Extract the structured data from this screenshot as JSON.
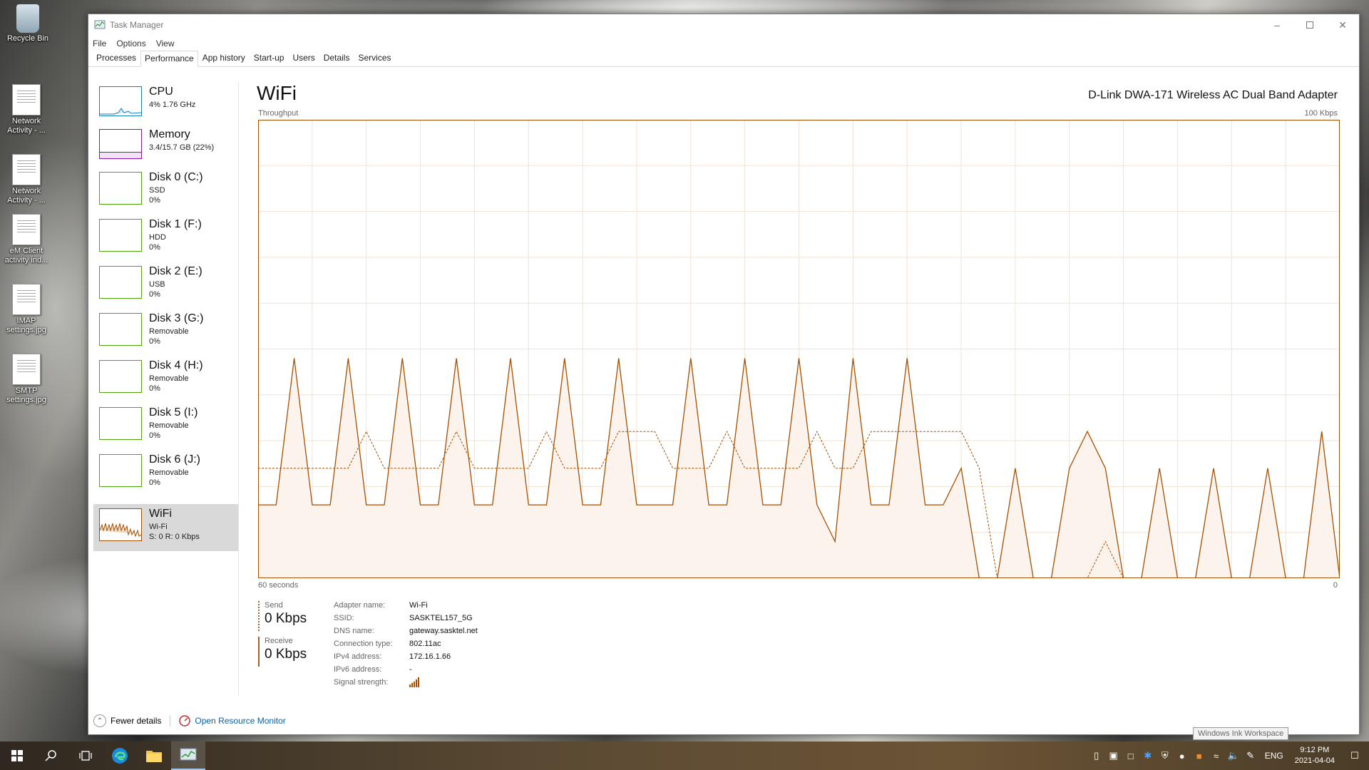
{
  "desktop": {
    "icons": [
      {
        "label": "Recycle Bin",
        "icon": "recycle-bin-icon"
      },
      {
        "label": "Network Activity - ...",
        "icon": "shortcut-icon"
      },
      {
        "label": "Network Activity - ...",
        "icon": "shortcut-icon"
      },
      {
        "label": "eM Client activity ind...",
        "icon": "document-icon"
      },
      {
        "label": "IMAP settings.jpg",
        "icon": "image-file-icon"
      },
      {
        "label": "SMTP settings.jpg",
        "icon": "image-file-icon"
      }
    ]
  },
  "window": {
    "title": "Task Manager",
    "menu": [
      "File",
      "Options",
      "View"
    ],
    "tabs": [
      "Processes",
      "Performance",
      "App history",
      "Start-up",
      "Users",
      "Details",
      "Services"
    ],
    "active_tab": "Performance"
  },
  "sidebar": {
    "items": [
      {
        "name": "CPU",
        "sub1": "4% 1.76 GHz",
        "sub2": "",
        "color": "#117dbb"
      },
      {
        "name": "Memory",
        "sub1": "3.4/15.7 GB (22%)",
        "sub2": "",
        "color": "#8b12ae"
      },
      {
        "name": "Disk 0 (C:)",
        "sub1": "SSD",
        "sub2": "0%",
        "color": "#4da60c"
      },
      {
        "name": "Disk 1 (F:)",
        "sub1": "HDD",
        "sub2": "0%",
        "color": "#4da60c"
      },
      {
        "name": "Disk 2 (E:)",
        "sub1": "USB",
        "sub2": "0%",
        "color": "#4da60c"
      },
      {
        "name": "Disk 3 (G:)",
        "sub1": "Removable",
        "sub2": "0%",
        "color": "#4da60c"
      },
      {
        "name": "Disk 4 (H:)",
        "sub1": "Removable",
        "sub2": "0%",
        "color": "#4da60c"
      },
      {
        "name": "Disk 5 (I:)",
        "sub1": "Removable",
        "sub2": "0%",
        "color": "#4da60c"
      },
      {
        "name": "Disk 6 (J:)",
        "sub1": "Removable",
        "sub2": "0%",
        "color": "#4da60c"
      },
      {
        "name": "WiFi",
        "sub1": "Wi-Fi",
        "sub2": "S: 0 R: 0 Kbps",
        "color": "#a74f01"
      }
    ],
    "selected": "WiFi"
  },
  "main": {
    "title": "WiFi",
    "adapter": "D-Link DWA-171 Wireless AC Dual Band Adapter",
    "throughput_label": "Throughput",
    "max_label": "100 Kbps",
    "time_left_label": "60 seconds",
    "time_right_label": "0",
    "send_label": "Send",
    "send_value": "0 Kbps",
    "receive_label": "Receive",
    "receive_value": "0 Kbps",
    "properties": [
      {
        "key": "Adapter name:",
        "value": "Wi-Fi"
      },
      {
        "key": "SSID:",
        "value": "SASKTEL157_5G"
      },
      {
        "key": "DNS name:",
        "value": "gateway.sasktel.net"
      },
      {
        "key": "Connection type:",
        "value": "802.11ac"
      },
      {
        "key": "IPv4 address:",
        "value": "172.16.1.66"
      },
      {
        "key": "IPv6 address:",
        "value": "-"
      },
      {
        "key": "Signal strength:",
        "value": ""
      }
    ]
  },
  "footer": {
    "fewer_details": "Fewer details",
    "open_resource_monitor": "Open Resource Monitor"
  },
  "chart_data": {
    "type": "area",
    "ylim": [
      0,
      100
    ],
    "xlim": [
      60,
      0
    ],
    "color": "#a74f01",
    "x": [
      60,
      59,
      58,
      57,
      56,
      55,
      54,
      53,
      52,
      51,
      50,
      49,
      48,
      47,
      46,
      45,
      44,
      43,
      42,
      41,
      40,
      39,
      38,
      37,
      36,
      35,
      34,
      33,
      32,
      31,
      30,
      29,
      28,
      27,
      26,
      25,
      24,
      23,
      22,
      21,
      20,
      19,
      18,
      17,
      16,
      15,
      14,
      13,
      12,
      11,
      10,
      9,
      8,
      7,
      6,
      5,
      4,
      3,
      2,
      1,
      0
    ],
    "series": [
      {
        "values": [
          16,
          16,
          48,
          16,
          16,
          48,
          16,
          16,
          48,
          16,
          16,
          48,
          16,
          16,
          48,
          16,
          16,
          48,
          16,
          16,
          48,
          16,
          16,
          16,
          48,
          16,
          16,
          48,
          16,
          16,
          48,
          16,
          8,
          48,
          16,
          16,
          48,
          16,
          16,
          24,
          0,
          0,
          24,
          0,
          0,
          24,
          32,
          24,
          0,
          0,
          24,
          0,
          0,
          24,
          0,
          0,
          24,
          0,
          0,
          32,
          0
        ]
      },
      {
        "values": [
          24,
          24,
          24,
          24,
          24,
          24,
          32,
          24,
          24,
          24,
          24,
          32,
          24,
          24,
          24,
          24,
          32,
          24,
          24,
          24,
          32,
          32,
          32,
          24,
          24,
          24,
          32,
          24,
          24,
          24,
          24,
          32,
          24,
          24,
          32,
          32,
          32,
          32,
          32,
          32,
          24,
          0,
          0,
          0,
          0,
          0,
          0,
          8,
          0,
          0,
          0,
          0,
          0,
          0,
          0,
          0,
          0,
          0,
          0,
          0,
          0
        ]
      }
    ]
  },
  "taskbar": {
    "lang": "ENG",
    "time": "9:12 PM",
    "date": "2021-04-04",
    "tooltip": "Windows Ink Workspace"
  }
}
